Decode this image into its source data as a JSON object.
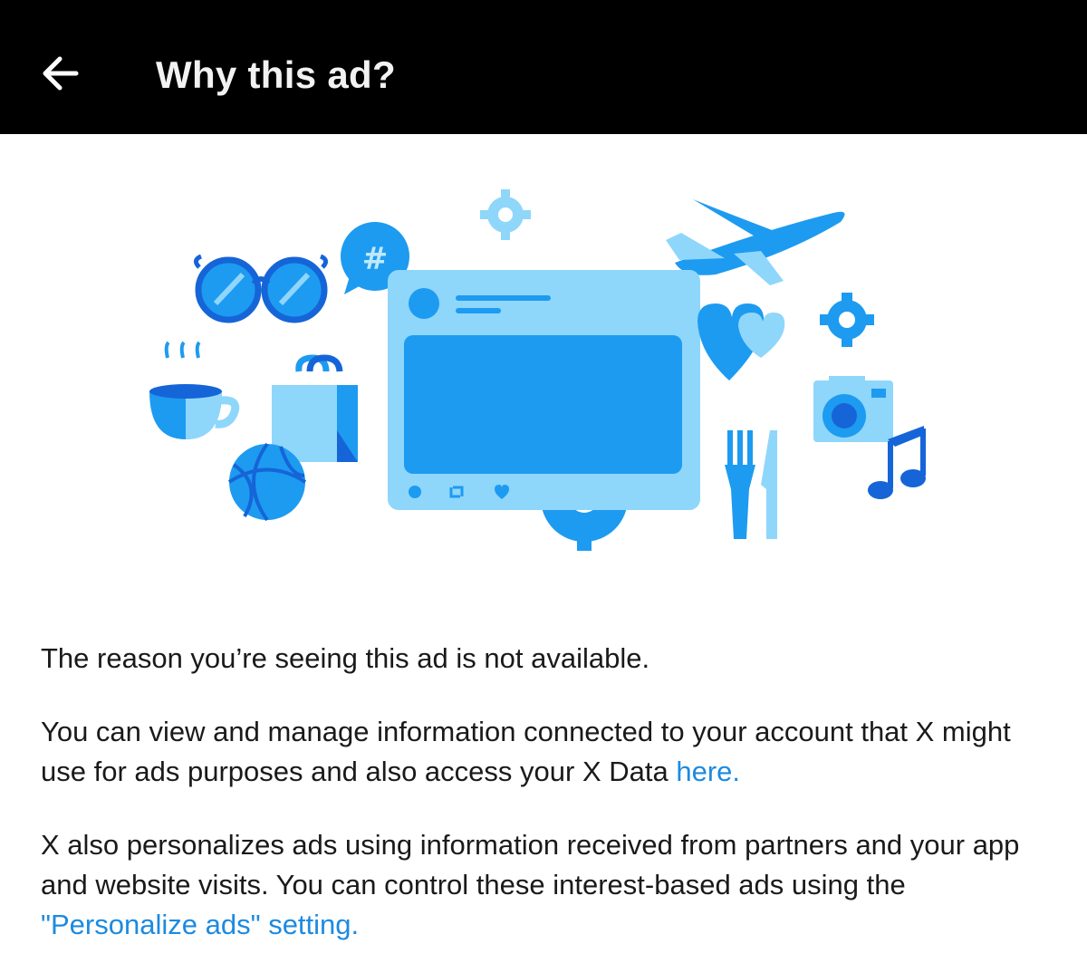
{
  "header": {
    "back_icon": "arrow-left-icon",
    "title": "Why this ad?"
  },
  "illustration": {
    "colors": {
      "dark": "#1565d8",
      "mid": "#1d9bf0",
      "light": "#8fd6fb",
      "pale": "#bfe8fd"
    }
  },
  "body": {
    "reason_text": "The reason you’re seeing this ad is not available.",
    "manage_text": "You can view and manage information connected to your account that X might use for ads purposes and also access your X Data",
    "manage_link": "here.",
    "personalize_text": "X also personalizes ads using information received from partners and your app and website visits. You can control these interest-based ads using the",
    "personalize_link": "\"Personalize ads\" setting."
  }
}
